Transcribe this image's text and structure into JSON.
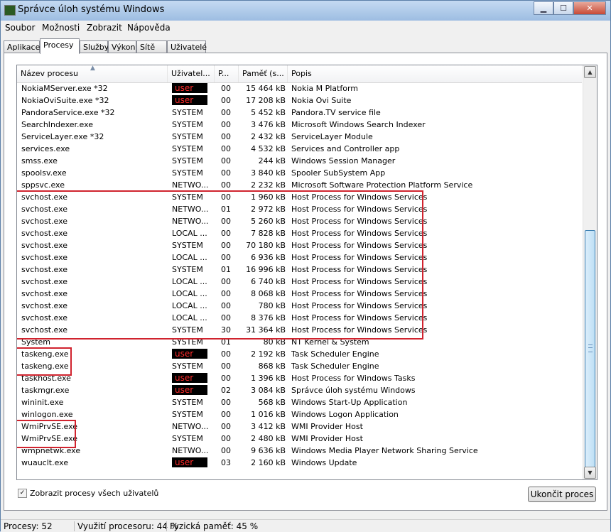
{
  "window": {
    "title": "Správce úloh systému Windows",
    "min": "▁",
    "max": "☐",
    "close": "✕"
  },
  "menu": [
    "Soubor",
    "Možnosti",
    "Zobrazit",
    "Nápověda"
  ],
  "tabs": [
    "Aplikace",
    "Procesy",
    "Služby",
    "Výkon",
    "Sítě",
    "Uživatelé"
  ],
  "active_tab": "Procesy",
  "columns": {
    "name": "Název procesu",
    "user": "Uživatel...",
    "cpu": "P...",
    "mem": "Paměť (s...",
    "desc": "Popis",
    "sort_indicator": "▲"
  },
  "processes": [
    {
      "name": "NokiaMServer.exe *32",
      "user": "user",
      "cpu": "00",
      "mem": "15 464 kB",
      "desc": "Nokia M Platform"
    },
    {
      "name": "NokiaOviSuite.exe *32",
      "user": "user",
      "cpu": "00",
      "mem": "17 208 kB",
      "desc": "Nokia Ovi Suite"
    },
    {
      "name": "PandoraService.exe *32",
      "user": "SYSTEM",
      "cpu": "00",
      "mem": "5 452 kB",
      "desc": "Pandora.TV service file"
    },
    {
      "name": "SearchIndexer.exe",
      "user": "SYSTEM",
      "cpu": "00",
      "mem": "3 476 kB",
      "desc": "Microsoft Windows Search Indexer"
    },
    {
      "name": "ServiceLayer.exe *32",
      "user": "SYSTEM",
      "cpu": "00",
      "mem": "2 432 kB",
      "desc": "ServiceLayer Module"
    },
    {
      "name": "services.exe",
      "user": "SYSTEM",
      "cpu": "00",
      "mem": "4 532 kB",
      "desc": "Services and Controller app"
    },
    {
      "name": "smss.exe",
      "user": "SYSTEM",
      "cpu": "00",
      "mem": "244 kB",
      "desc": "Windows Session Manager"
    },
    {
      "name": "spoolsv.exe",
      "user": "SYSTEM",
      "cpu": "00",
      "mem": "3 840 kB",
      "desc": "Spooler SubSystem App"
    },
    {
      "name": "sppsvc.exe",
      "user": "NETWO...",
      "cpu": "00",
      "mem": "2 232 kB",
      "desc": "Microsoft Software Protection Platform Service"
    },
    {
      "name": "svchost.exe",
      "user": "SYSTEM",
      "cpu": "00",
      "mem": "1 960 kB",
      "desc": "Host Process for Windows Services"
    },
    {
      "name": "svchost.exe",
      "user": "NETWO...",
      "cpu": "01",
      "mem": "2 972 kB",
      "desc": "Host Process for Windows Services"
    },
    {
      "name": "svchost.exe",
      "user": "NETWO...",
      "cpu": "00",
      "mem": "5 260 kB",
      "desc": "Host Process for Windows Services"
    },
    {
      "name": "svchost.exe",
      "user": "LOCAL ...",
      "cpu": "00",
      "mem": "7 828 kB",
      "desc": "Host Process for Windows Services"
    },
    {
      "name": "svchost.exe",
      "user": "SYSTEM",
      "cpu": "00",
      "mem": "70 180 kB",
      "desc": "Host Process for Windows Services"
    },
    {
      "name": "svchost.exe",
      "user": "LOCAL ...",
      "cpu": "00",
      "mem": "6 936 kB",
      "desc": "Host Process for Windows Services"
    },
    {
      "name": "svchost.exe",
      "user": "SYSTEM",
      "cpu": "01",
      "mem": "16 996 kB",
      "desc": "Host Process for Windows Services"
    },
    {
      "name": "svchost.exe",
      "user": "LOCAL ...",
      "cpu": "00",
      "mem": "6 740 kB",
      "desc": "Host Process for Windows Services"
    },
    {
      "name": "svchost.exe",
      "user": "LOCAL ...",
      "cpu": "00",
      "mem": "8 068 kB",
      "desc": "Host Process for Windows Services"
    },
    {
      "name": "svchost.exe",
      "user": "LOCAL ...",
      "cpu": "00",
      "mem": "780 kB",
      "desc": "Host Process for Windows Services"
    },
    {
      "name": "svchost.exe",
      "user": "LOCAL ...",
      "cpu": "00",
      "mem": "8 376 kB",
      "desc": "Host Process for Windows Services"
    },
    {
      "name": "svchost.exe",
      "user": "SYSTEM",
      "cpu": "30",
      "mem": "31 364 kB",
      "desc": "Host Process for Windows Services"
    },
    {
      "name": "System",
      "user": "SYSTEM",
      "cpu": "01",
      "mem": "80 kB",
      "desc": "NT Kernel & System"
    },
    {
      "name": "taskeng.exe",
      "user": "user",
      "cpu": "00",
      "mem": "2 192 kB",
      "desc": "Task Scheduler Engine"
    },
    {
      "name": "taskeng.exe",
      "user": "SYSTEM",
      "cpu": "00",
      "mem": "868 kB",
      "desc": "Task Scheduler Engine"
    },
    {
      "name": "taskhost.exe",
      "user": "user",
      "cpu": "00",
      "mem": "1 396 kB",
      "desc": "Host Process for Windows Tasks"
    },
    {
      "name": "taskmgr.exe",
      "user": "user",
      "cpu": "02",
      "mem": "3 084 kB",
      "desc": "Správce úloh systému Windows"
    },
    {
      "name": "wininit.exe",
      "user": "SYSTEM",
      "cpu": "00",
      "mem": "568 kB",
      "desc": "Windows Start-Up Application"
    },
    {
      "name": "winlogon.exe",
      "user": "SYSTEM",
      "cpu": "00",
      "mem": "1 016 kB",
      "desc": "Windows Logon Application"
    },
    {
      "name": "WmiPrvSE.exe",
      "user": "NETWO...",
      "cpu": "00",
      "mem": "3 412 kB",
      "desc": "WMI Provider Host"
    },
    {
      "name": "WmiPrvSE.exe",
      "user": "SYSTEM",
      "cpu": "00",
      "mem": "2 480 kB",
      "desc": "WMI Provider Host"
    },
    {
      "name": "wmpnetwk.exe",
      "user": "NETWO...",
      "cpu": "00",
      "mem": "9 636 kB",
      "desc": "Windows Media Player Network Sharing Service"
    },
    {
      "name": "wuauclt.exe",
      "user": "user",
      "cpu": "03",
      "mem": "2 160 kB",
      "desc": "Windows Update"
    }
  ],
  "show_all_users": {
    "label": "Zobrazit procesy všech uživatelů",
    "checked": true
  },
  "end_process_button": "Ukončit proces",
  "status": {
    "processes": "Procesy: 52",
    "cpu": "Využití procesoru: 44 %",
    "memory": "Fyzická paměť: 45 %"
  },
  "colors": {
    "highlight": "#d0232e",
    "user_text": "#ff2a2a"
  },
  "scrollbar": {
    "up": "▲",
    "down": "▼"
  }
}
